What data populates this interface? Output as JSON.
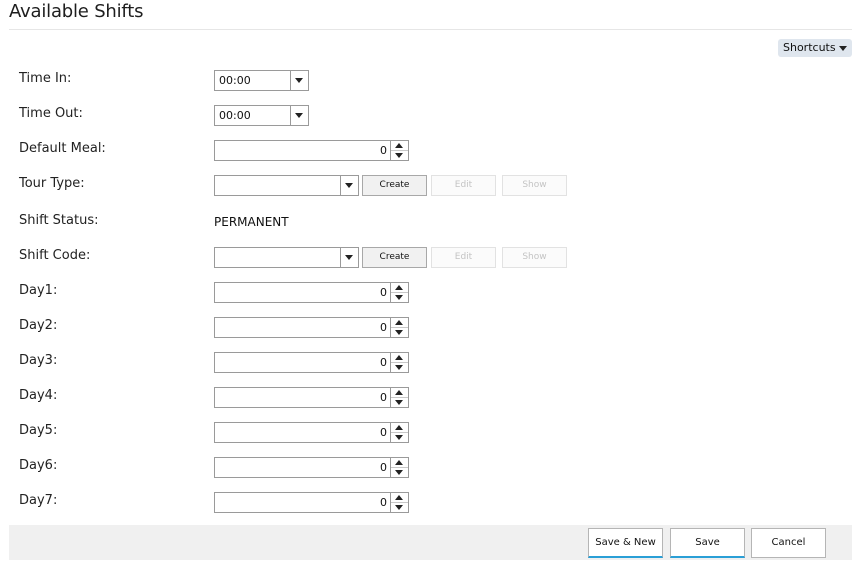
{
  "page": {
    "title": "Available Shifts",
    "shortcuts_label": "Shortcuts"
  },
  "fields": {
    "time_in": {
      "label": "Time In:",
      "value": "00:00"
    },
    "time_out": {
      "label": "Time Out:",
      "value": "00:00"
    },
    "default_meal": {
      "label": "Default Meal:",
      "value": "0"
    },
    "tour_type": {
      "label": "Tour Type:",
      "value": ""
    },
    "shift_status": {
      "label": "Shift Status:",
      "value": "PERMANENT"
    },
    "shift_code": {
      "label": "Shift Code:",
      "value": ""
    },
    "day1": {
      "label": "Day1:",
      "value": "0"
    },
    "day2": {
      "label": "Day2:",
      "value": "0"
    },
    "day3": {
      "label": "Day3:",
      "value": "0"
    },
    "day4": {
      "label": "Day4:",
      "value": "0"
    },
    "day5": {
      "label": "Day5:",
      "value": "0"
    },
    "day6": {
      "label": "Day6:",
      "value": "0"
    },
    "day7": {
      "label": "Day7:",
      "value": "0"
    }
  },
  "actions": {
    "create": "Create",
    "edit": "Edit",
    "show": "Show"
  },
  "footer": {
    "save_new": "Save & New",
    "save": "Save",
    "cancel": "Cancel"
  },
  "colors": {
    "accent": "#2a9fd6",
    "shortcuts_bg": "#dfe6ee",
    "footer_bg": "#f0f0f0"
  }
}
